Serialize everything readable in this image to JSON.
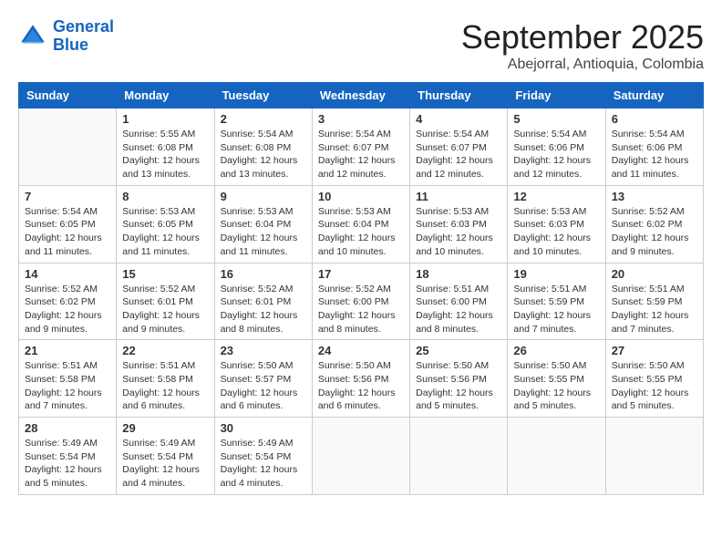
{
  "header": {
    "logo_line1": "General",
    "logo_line2": "Blue",
    "month": "September 2025",
    "location": "Abejorral, Antioquia, Colombia"
  },
  "days_of_week": [
    "Sunday",
    "Monday",
    "Tuesday",
    "Wednesday",
    "Thursday",
    "Friday",
    "Saturday"
  ],
  "weeks": [
    [
      {
        "day": "",
        "info": ""
      },
      {
        "day": "1",
        "info": "Sunrise: 5:55 AM\nSunset: 6:08 PM\nDaylight: 12 hours\nand 13 minutes."
      },
      {
        "day": "2",
        "info": "Sunrise: 5:54 AM\nSunset: 6:08 PM\nDaylight: 12 hours\nand 13 minutes."
      },
      {
        "day": "3",
        "info": "Sunrise: 5:54 AM\nSunset: 6:07 PM\nDaylight: 12 hours\nand 12 minutes."
      },
      {
        "day": "4",
        "info": "Sunrise: 5:54 AM\nSunset: 6:07 PM\nDaylight: 12 hours\nand 12 minutes."
      },
      {
        "day": "5",
        "info": "Sunrise: 5:54 AM\nSunset: 6:06 PM\nDaylight: 12 hours\nand 12 minutes."
      },
      {
        "day": "6",
        "info": "Sunrise: 5:54 AM\nSunset: 6:06 PM\nDaylight: 12 hours\nand 11 minutes."
      }
    ],
    [
      {
        "day": "7",
        "info": "Sunrise: 5:54 AM\nSunset: 6:05 PM\nDaylight: 12 hours\nand 11 minutes."
      },
      {
        "day": "8",
        "info": "Sunrise: 5:53 AM\nSunset: 6:05 PM\nDaylight: 12 hours\nand 11 minutes."
      },
      {
        "day": "9",
        "info": "Sunrise: 5:53 AM\nSunset: 6:04 PM\nDaylight: 12 hours\nand 11 minutes."
      },
      {
        "day": "10",
        "info": "Sunrise: 5:53 AM\nSunset: 6:04 PM\nDaylight: 12 hours\nand 10 minutes."
      },
      {
        "day": "11",
        "info": "Sunrise: 5:53 AM\nSunset: 6:03 PM\nDaylight: 12 hours\nand 10 minutes."
      },
      {
        "day": "12",
        "info": "Sunrise: 5:53 AM\nSunset: 6:03 PM\nDaylight: 12 hours\nand 10 minutes."
      },
      {
        "day": "13",
        "info": "Sunrise: 5:52 AM\nSunset: 6:02 PM\nDaylight: 12 hours\nand 9 minutes."
      }
    ],
    [
      {
        "day": "14",
        "info": "Sunrise: 5:52 AM\nSunset: 6:02 PM\nDaylight: 12 hours\nand 9 minutes."
      },
      {
        "day": "15",
        "info": "Sunrise: 5:52 AM\nSunset: 6:01 PM\nDaylight: 12 hours\nand 9 minutes."
      },
      {
        "day": "16",
        "info": "Sunrise: 5:52 AM\nSunset: 6:01 PM\nDaylight: 12 hours\nand 8 minutes."
      },
      {
        "day": "17",
        "info": "Sunrise: 5:52 AM\nSunset: 6:00 PM\nDaylight: 12 hours\nand 8 minutes."
      },
      {
        "day": "18",
        "info": "Sunrise: 5:51 AM\nSunset: 6:00 PM\nDaylight: 12 hours\nand 8 minutes."
      },
      {
        "day": "19",
        "info": "Sunrise: 5:51 AM\nSunset: 5:59 PM\nDaylight: 12 hours\nand 7 minutes."
      },
      {
        "day": "20",
        "info": "Sunrise: 5:51 AM\nSunset: 5:59 PM\nDaylight: 12 hours\nand 7 minutes."
      }
    ],
    [
      {
        "day": "21",
        "info": "Sunrise: 5:51 AM\nSunset: 5:58 PM\nDaylight: 12 hours\nand 7 minutes."
      },
      {
        "day": "22",
        "info": "Sunrise: 5:51 AM\nSunset: 5:58 PM\nDaylight: 12 hours\nand 6 minutes."
      },
      {
        "day": "23",
        "info": "Sunrise: 5:50 AM\nSunset: 5:57 PM\nDaylight: 12 hours\nand 6 minutes."
      },
      {
        "day": "24",
        "info": "Sunrise: 5:50 AM\nSunset: 5:56 PM\nDaylight: 12 hours\nand 6 minutes."
      },
      {
        "day": "25",
        "info": "Sunrise: 5:50 AM\nSunset: 5:56 PM\nDaylight: 12 hours\nand 5 minutes."
      },
      {
        "day": "26",
        "info": "Sunrise: 5:50 AM\nSunset: 5:55 PM\nDaylight: 12 hours\nand 5 minutes."
      },
      {
        "day": "27",
        "info": "Sunrise: 5:50 AM\nSunset: 5:55 PM\nDaylight: 12 hours\nand 5 minutes."
      }
    ],
    [
      {
        "day": "28",
        "info": "Sunrise: 5:49 AM\nSunset: 5:54 PM\nDaylight: 12 hours\nand 5 minutes."
      },
      {
        "day": "29",
        "info": "Sunrise: 5:49 AM\nSunset: 5:54 PM\nDaylight: 12 hours\nand 4 minutes."
      },
      {
        "day": "30",
        "info": "Sunrise: 5:49 AM\nSunset: 5:54 PM\nDaylight: 12 hours\nand 4 minutes."
      },
      {
        "day": "",
        "info": ""
      },
      {
        "day": "",
        "info": ""
      },
      {
        "day": "",
        "info": ""
      },
      {
        "day": "",
        "info": ""
      }
    ]
  ]
}
